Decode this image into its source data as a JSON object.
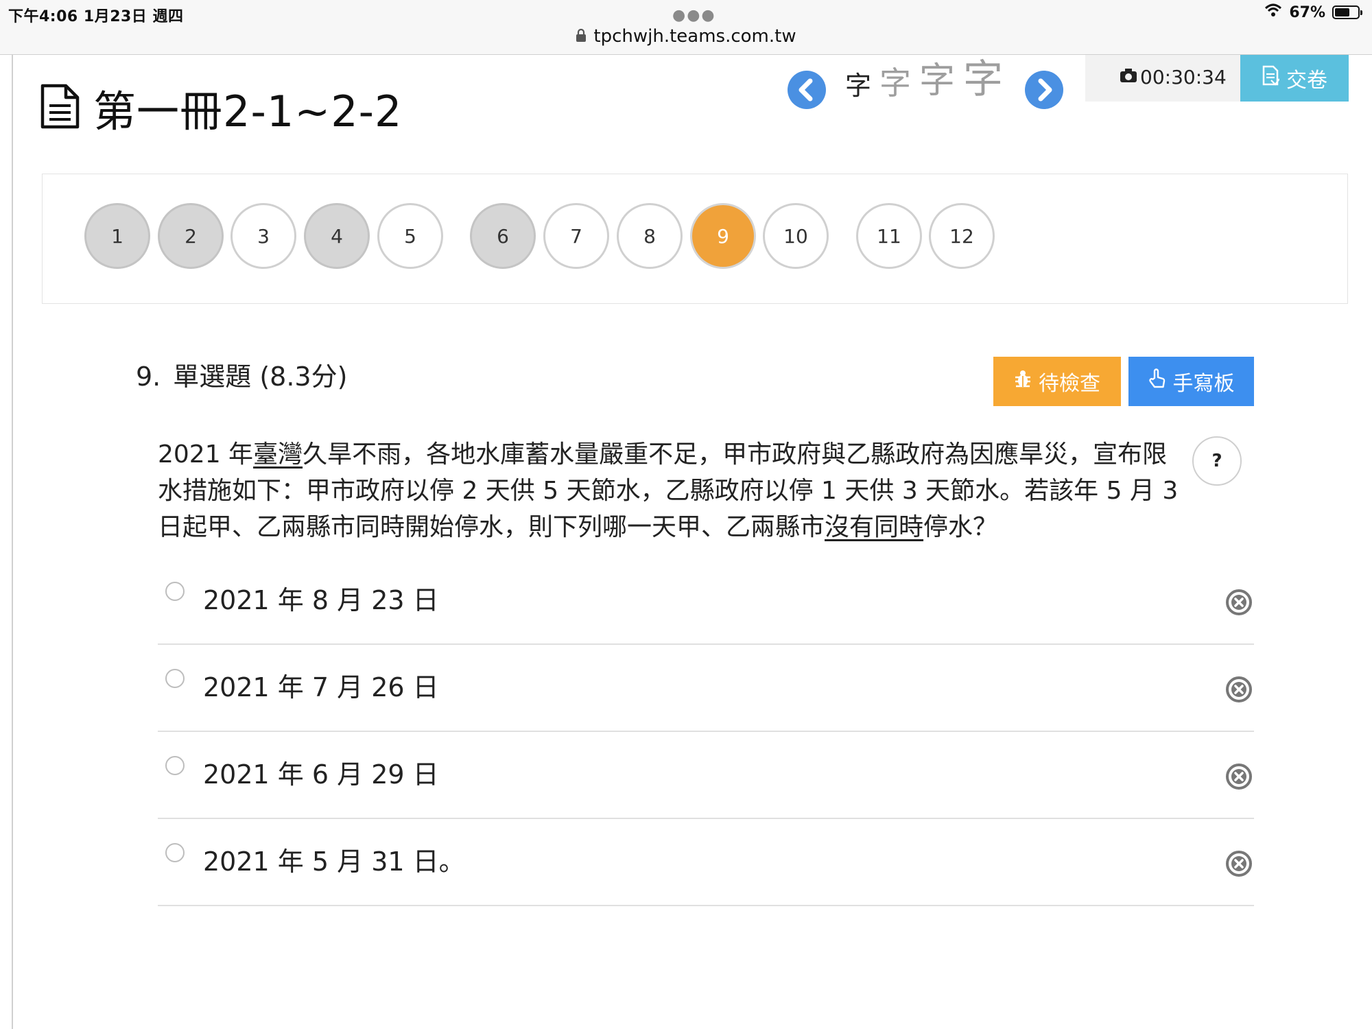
{
  "status_bar": {
    "time_date": "下午4:06   1月23日 週四",
    "url": "tpchwjh.teams.com.tw",
    "battery": "67%",
    "battery_level": 0.67
  },
  "header": {
    "title": "第一冊2-1~2-2",
    "fontsize_options": [
      "字",
      "字",
      "字",
      "字"
    ],
    "timer": "00:30:34",
    "submit_label": "交卷"
  },
  "question_nav": {
    "items": [
      {
        "label": "1",
        "state": "done"
      },
      {
        "label": "2",
        "state": "done"
      },
      {
        "label": "3",
        "state": "open"
      },
      {
        "label": "4",
        "state": "done"
      },
      {
        "label": "5",
        "state": "open"
      },
      {
        "label": "6",
        "state": "done"
      },
      {
        "label": "7",
        "state": "open"
      },
      {
        "label": "8",
        "state": "open"
      },
      {
        "label": "9",
        "state": "current"
      },
      {
        "label": "10",
        "state": "open"
      },
      {
        "label": "11",
        "state": "open"
      },
      {
        "label": "12",
        "state": "open"
      }
    ]
  },
  "question": {
    "number": "9.",
    "type": "單選題 (8.3分)",
    "review_label": "待檢查",
    "handwrite_label": "手寫板",
    "help_label": "?",
    "stem": {
      "p1": "2021 年",
      "u1": "臺灣",
      "p2": "久旱不雨，各地水庫蓄水量嚴重不足，甲市政府與乙縣政府為因應旱災，宣布限水措施如下：甲市政府以停 2 天供 5 天節水，乙縣政府以停 1 天供 3 天節水。若該年 5 月 3 日起甲、乙兩縣市同時開始停水，則下列哪一天甲、乙兩縣市",
      "u2": "沒有同時",
      "p3": "停水？"
    },
    "options": [
      "2021 年 8 月 23 日",
      "2021 年 7 月 26 日",
      "2021 年 6 月 29 日",
      "2021 年 5 月 31 日。"
    ]
  }
}
